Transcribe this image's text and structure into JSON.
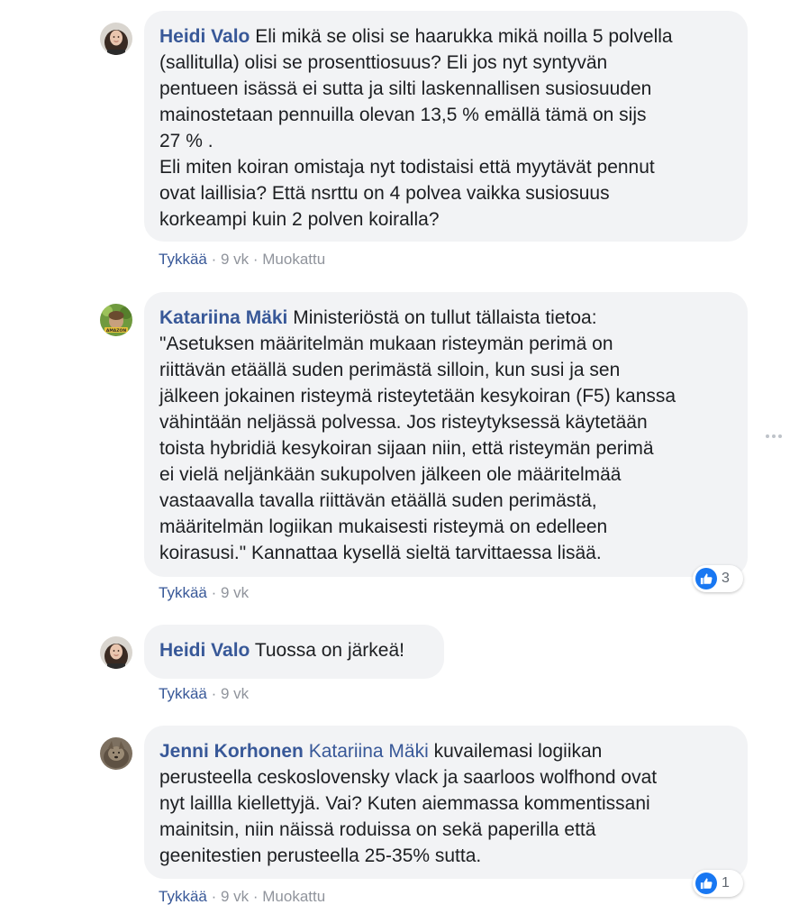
{
  "comments": [
    {
      "author": "Heidi Valo",
      "mention": "",
      "text": " Eli mikä se olisi se haarukka mikä noilla 5 polvella\n(sallitulla) olisi se prosenttiosuus? Eli jos nyt syntyvän\npentueen isässä ei sutta ja silti laskennallisen susiosuuden\nmainostetaan pennuilla olevan 13,5 % emällä tämä on sijs\n27 % .\nEli miten koiran omistaja nyt todistaisi että myytävät pennut\novat laillisia? Että nsrttu on 4 polvea vaikka susiosuus\nkorkeampi kuin 2 polven koiralla?",
      "like_label": "Tykkää",
      "separator": " · ",
      "time": "9 vk",
      "edited": "Muokattu",
      "reaction_count": ""
    },
    {
      "author": "Katariina Mäki",
      "mention": "",
      "text": " Ministeriöstä on tullut tällaista tietoa:\n\"Asetuksen määritelmän mukaan risteymän perimä on\nriittävän etäällä suden perimästä silloin, kun susi ja sen\njälkeen jokainen risteymä risteytetään kesykoiran (F5) kanssa\nvähintään neljässä polvessa. Jos risteytyksessä käytetään\ntoista hybridiä kesykoiran sijaan niin, että risteymän perimä\nei vielä neljänkään sukupolven jälkeen ole määritelmää\nvastaavalla tavalla riittävän etäällä suden perimästä,\nmääritelmän logiikan mukaisesti risteymä on edelleen\nkoirasusi.\" Kannattaa kysellä sieltä tarvittaessa lisää.",
      "like_label": "Tykkää",
      "separator": " · ",
      "time": "9 vk",
      "edited": "",
      "reaction_count": "3",
      "avatar_badge": "AMAZON"
    },
    {
      "author": "Heidi Valo",
      "mention": "",
      "text": " Tuossa on järkeä!",
      "like_label": "Tykkää",
      "separator": " · ",
      "time": "9 vk",
      "edited": "",
      "reaction_count": ""
    },
    {
      "author": "Jenni Korhonen",
      "mention": "Katariina Mäki",
      "text": " kuvailemasi logiikan\nperusteella ceskoslovensky vlack ja saarloos wolfhond ovat\nnyt laillla kiellettyjä. Vai? Kuten aiemmassa kommentissani\nmainitsin, niin näissä roduissa on sekä paperilla että\ngeenitestien perusteella 25-35% sutta.",
      "like_label": "Tykkää",
      "separator": " · ",
      "time": "9 vk",
      "edited": "Muokattu",
      "reaction_count": "1"
    }
  ],
  "icons": {
    "reaction": "thumbs-up-icon",
    "more": "more-options-icon"
  },
  "colors": {
    "author": "#385898",
    "bubble": "#f2f3f5",
    "meta": "#90949c",
    "like_badge": "#1877f2"
  }
}
